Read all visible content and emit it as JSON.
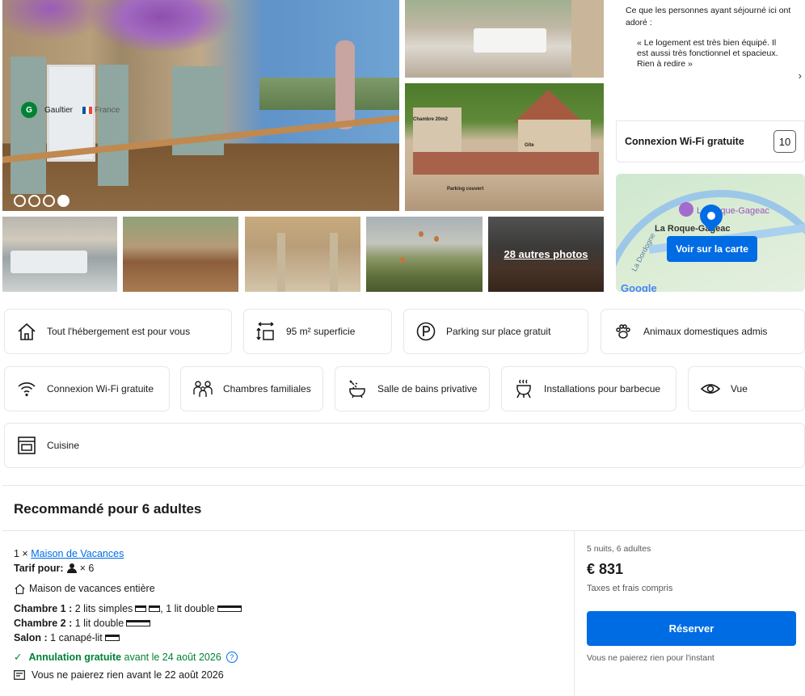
{
  "gallery": {
    "more_photos": "28 autres photos",
    "photo_labels": {
      "bedroom": "Chambre 20m2",
      "gite": "Gîte",
      "parking": "Parking couvert"
    }
  },
  "review": {
    "intro": "Ce que les personnes ayant séjourné ici ont adoré :",
    "quote": "« Le logement est très bien équipé. Il est aussi très fonctionnel et spacieux. Rien à redire »",
    "reviewer_initial": "G",
    "reviewer_name": "Gaultier",
    "reviewer_country": "France"
  },
  "wifi_score": {
    "label": "Connexion Wi-Fi gratuite",
    "score": "10"
  },
  "map": {
    "city": "La Roque-Gageac",
    "poi": "La Roque-Gageac",
    "river_label": "La Dordogne",
    "button": "Voir sur la carte",
    "provider": "Google"
  },
  "facilities": [
    {
      "label": "Tout l'hébergement est pour vous",
      "icon": "house-icon"
    },
    {
      "label": "95 m² superficie",
      "icon": "size-icon"
    },
    {
      "label": "Parking sur place gratuit",
      "icon": "parking-icon"
    },
    {
      "label": "Animaux domestiques admis",
      "icon": "paw-icon"
    },
    {
      "label": "Connexion Wi-Fi gratuite",
      "icon": "wifi-icon"
    },
    {
      "label": "Chambres familiales",
      "icon": "family-icon"
    },
    {
      "label": "Salle de bains privative",
      "icon": "bath-icon"
    },
    {
      "label": "Installations pour barbecue",
      "icon": "barbecue-icon"
    },
    {
      "label": "Vue",
      "icon": "eye-icon"
    },
    {
      "label": "Cuisine",
      "icon": "oven-icon"
    }
  ],
  "recommendation": {
    "title": "Recommandé pour 6 adultes",
    "quantity": "1 ×",
    "unit_name": "Maison de Vacances",
    "rate_label": "Tarif pour:",
    "rate_count": "× 6",
    "unit_type": "Maison de vacances entière",
    "room1_label": "Chambre 1 :",
    "room1_beds": "2 lits simples",
    "room1_beds2": ", 1 lit double",
    "room2_label": "Chambre 2 :",
    "room2_beds": "1 lit double",
    "salon_label": "Salon :",
    "salon_beds": "1 canapé-lit",
    "cancellation_bold": "Annulation gratuite",
    "cancellation_rest": "avant le 24 août 2026",
    "pay_later": "Vous ne paierez rien avant le 22 août 2026",
    "stay_summary": "5 nuits, 6 adultes",
    "price": "€ 831",
    "taxes": "Taxes et frais compris",
    "reserve_button": "Réserver",
    "no_pay_note": "Vous ne paierez rien pour l'instant"
  },
  "colors": {
    "brand_blue": "#006ce4",
    "green": "#008234",
    "border": "#e7e7e7"
  }
}
